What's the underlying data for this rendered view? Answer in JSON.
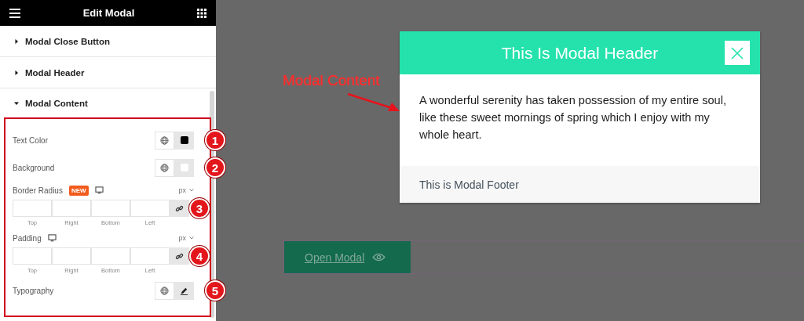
{
  "panel": {
    "title": "Edit Modal",
    "sections": [
      {
        "label": "Modal Close Button",
        "expanded": false
      },
      {
        "label": "Modal Header",
        "expanded": false
      },
      {
        "label": "Modal Content",
        "expanded": true
      }
    ],
    "controls": [
      {
        "kind": "color",
        "label": "Text Color",
        "color": "#000000",
        "marker": "1"
      },
      {
        "kind": "color",
        "label": "Background",
        "color": "#ffffff",
        "marker": "2"
      },
      {
        "kind": "dimensions",
        "label": "Border Radius",
        "badge": "NEW",
        "unit": "px",
        "sides": [
          "Top",
          "Right",
          "Bottom",
          "Left"
        ],
        "marker": "3"
      },
      {
        "kind": "dimensions",
        "label": "Padding",
        "unit": "px",
        "sides": [
          "Top",
          "Right",
          "Bottom",
          "Left"
        ],
        "marker": "4"
      },
      {
        "kind": "typography",
        "label": "Typography",
        "marker": "5"
      }
    ]
  },
  "annotation": "Modal Content",
  "modal": {
    "header": "This Is Modal Header",
    "body": "A wonderful serenity has taken possession of my entire soul, like these sweet mornings of spring which I enjoy with my whole heart.",
    "footer": "This is Modal Footer"
  },
  "button": {
    "label": "Open Modal"
  }
}
